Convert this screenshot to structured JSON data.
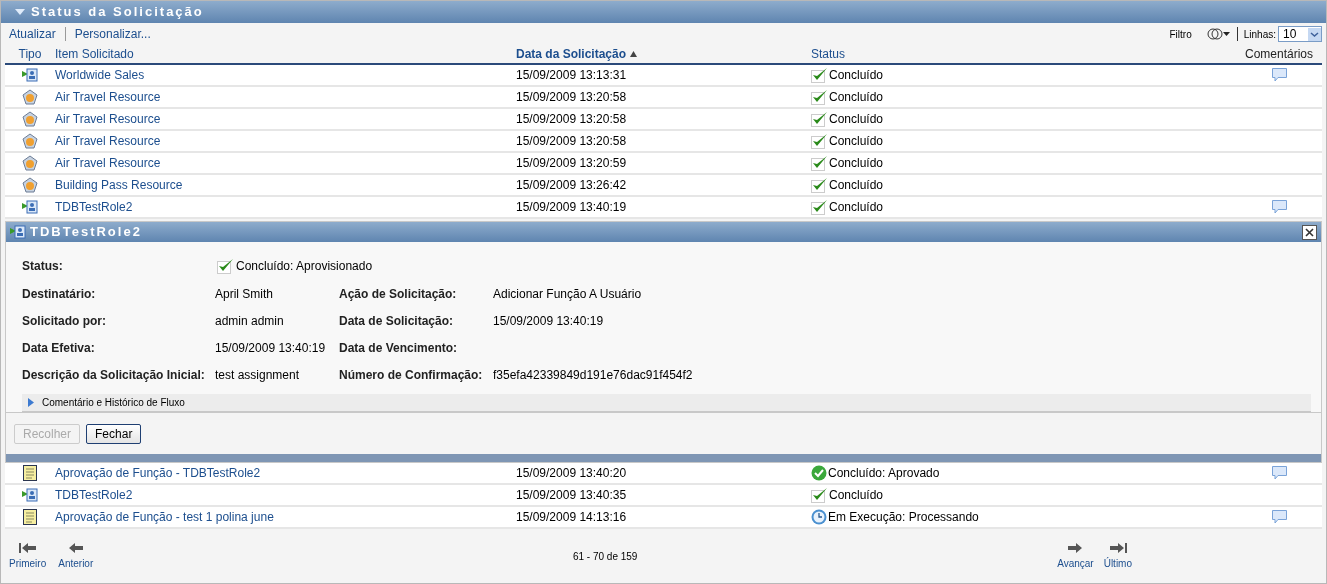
{
  "panel": {
    "title": "Status da Solicitação",
    "expanded": true
  },
  "toolbar": {
    "actions": [
      "Atualizar",
      "Personalizar..."
    ],
    "filter_label": "Filtro",
    "rows_label": "Linhas:",
    "rows_value": "10"
  },
  "table": {
    "columns": [
      {
        "label": "Tipo",
        "sorted": false
      },
      {
        "label": "Item Solicitado",
        "sorted": false
      },
      {
        "label": "Data da Solicitação",
        "sorted": true
      },
      {
        "label": "Status",
        "sorted": false
      },
      {
        "label": "Comentários",
        "sorted": false
      }
    ],
    "rows_top": [
      {
        "kind": "role",
        "item": "Worldwide Sales",
        "date": "15/09/2009 13:13:31",
        "status": {
          "kind": "done",
          "text": "Concluído"
        },
        "comment": true
      },
      {
        "kind": "resource",
        "item": "Air Travel Resource",
        "date": "15/09/2009 13:20:58",
        "status": {
          "kind": "done",
          "text": "Concluído"
        },
        "comment": false
      },
      {
        "kind": "resource",
        "item": "Air Travel Resource",
        "date": "15/09/2009 13:20:58",
        "status": {
          "kind": "done",
          "text": "Concluído"
        },
        "comment": false
      },
      {
        "kind": "resource",
        "item": "Air Travel Resource",
        "date": "15/09/2009 13:20:58",
        "status": {
          "kind": "done",
          "text": "Concluído"
        },
        "comment": false
      },
      {
        "kind": "resource",
        "item": "Air Travel Resource",
        "date": "15/09/2009 13:20:59",
        "status": {
          "kind": "done",
          "text": "Concluído"
        },
        "comment": false
      },
      {
        "kind": "resource",
        "item": "Building Pass Resource",
        "date": "15/09/2009 13:26:42",
        "status": {
          "kind": "done",
          "text": "Concluído"
        },
        "comment": false
      },
      {
        "kind": "role",
        "item": "TDBTestRole2",
        "date": "15/09/2009 13:40:19",
        "status": {
          "kind": "done",
          "text": "Concluído"
        },
        "comment": true
      }
    ],
    "detail": {
      "title": "TDBTestRole2",
      "status_label": "Status:",
      "status": {
        "kind": "done",
        "text": "Concluído: Aprovisionado"
      },
      "fields": [
        {
          "label": "Destinatário:",
          "value": "April Smith",
          "label2": "Ação de Solicitação:",
          "value2": "Adicionar Função A Usuário"
        },
        {
          "label": "Solicitado por:",
          "value": "admin admin",
          "label2": "Data de Solicitação:",
          "value2": "15/09/2009 13:40:19"
        },
        {
          "label": "Data Efetiva:",
          "value": "15/09/2009 13:40:19",
          "label2": "Data de Vencimento:"
        },
        {
          "label": "Descrição da Solicitação Inicial:",
          "value": "test assignment",
          "label2": "Número de Confirmação:",
          "value2": "f35efa42339849d191e76dac91f454f2"
        }
      ],
      "history": {
        "label": "Comentário e Histórico de Fluxo",
        "expanded": false
      },
      "buttons": [
        {
          "label": "Recolher",
          "disabled": true
        },
        {
          "label": "Fechar",
          "disabled": false
        }
      ]
    },
    "rows_bottom": [
      {
        "kind": "approval",
        "item": "Aprovação de Função - TDBTestRole2",
        "date": "15/09/2009 13:40:20",
        "status": {
          "kind": "approved",
          "text": "Concluído: Aprovado"
        },
        "comment": true
      },
      {
        "kind": "role",
        "item": "TDBTestRole2",
        "date": "15/09/2009 13:40:35",
        "status": {
          "kind": "done",
          "text": "Concluído"
        },
        "comment": false
      },
      {
        "kind": "approval",
        "item": "Aprovação de Função - test 1 polina june",
        "date": "15/09/2009 14:13:16",
        "status": {
          "kind": "running",
          "text": "Em Execução: Processando"
        },
        "comment": true
      }
    ]
  },
  "pager": {
    "first": "Primeiro",
    "previous": "Anterior",
    "range": "61 - 70 de 159",
    "next": "Avançar",
    "last": "Último"
  }
}
